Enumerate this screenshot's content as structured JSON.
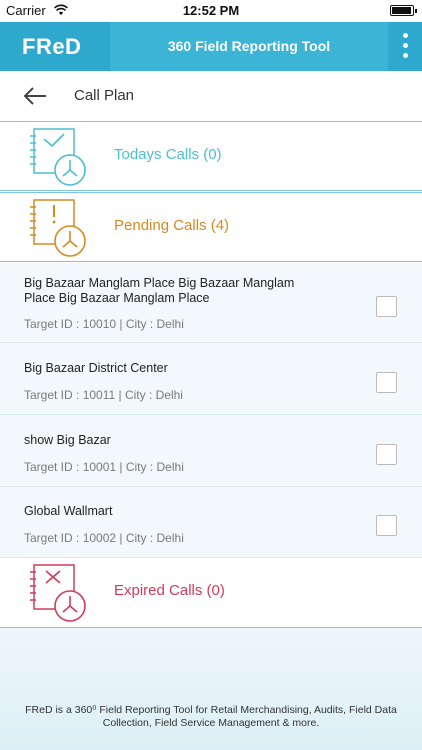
{
  "status_bar": {
    "carrier": "Carrier",
    "time": "12:52 PM"
  },
  "header": {
    "logo": "FReD",
    "title": "360 Field Reporting Tool"
  },
  "subheader": {
    "title": "Call Plan"
  },
  "sections": {
    "todays": {
      "label": "Todays Calls (0)",
      "color": "#4cbfcf"
    },
    "pending": {
      "label": "Pending Calls (4)",
      "color": "#d48a22"
    },
    "expired": {
      "label": "Expired Calls (0)",
      "color": "#d23a5a"
    }
  },
  "pending_items": [
    {
      "name": "Big Bazaar Manglam Place Big Bazaar Manglam Place Big Bazaar Manglam Place",
      "meta": "Target ID : 10010 | City : Delhi"
    },
    {
      "name": "Big Bazaar District Center",
      "meta": "Target ID : 10011 | City : Delhi"
    },
    {
      "name": "show Big Bazar",
      "meta": "Target ID : 10001 | City : Delhi"
    },
    {
      "name": "Global Wallmart",
      "meta": "Target ID : 10002 | City : Delhi"
    }
  ],
  "footer": {
    "text": "FReD is a 360⁰ Field Reporting Tool for Retail Merchandising, Audits, Field Data Collection, Field Service Management & more."
  },
  "colors": {
    "header": "#2fa8cd",
    "accent": "#3bb4d6"
  }
}
